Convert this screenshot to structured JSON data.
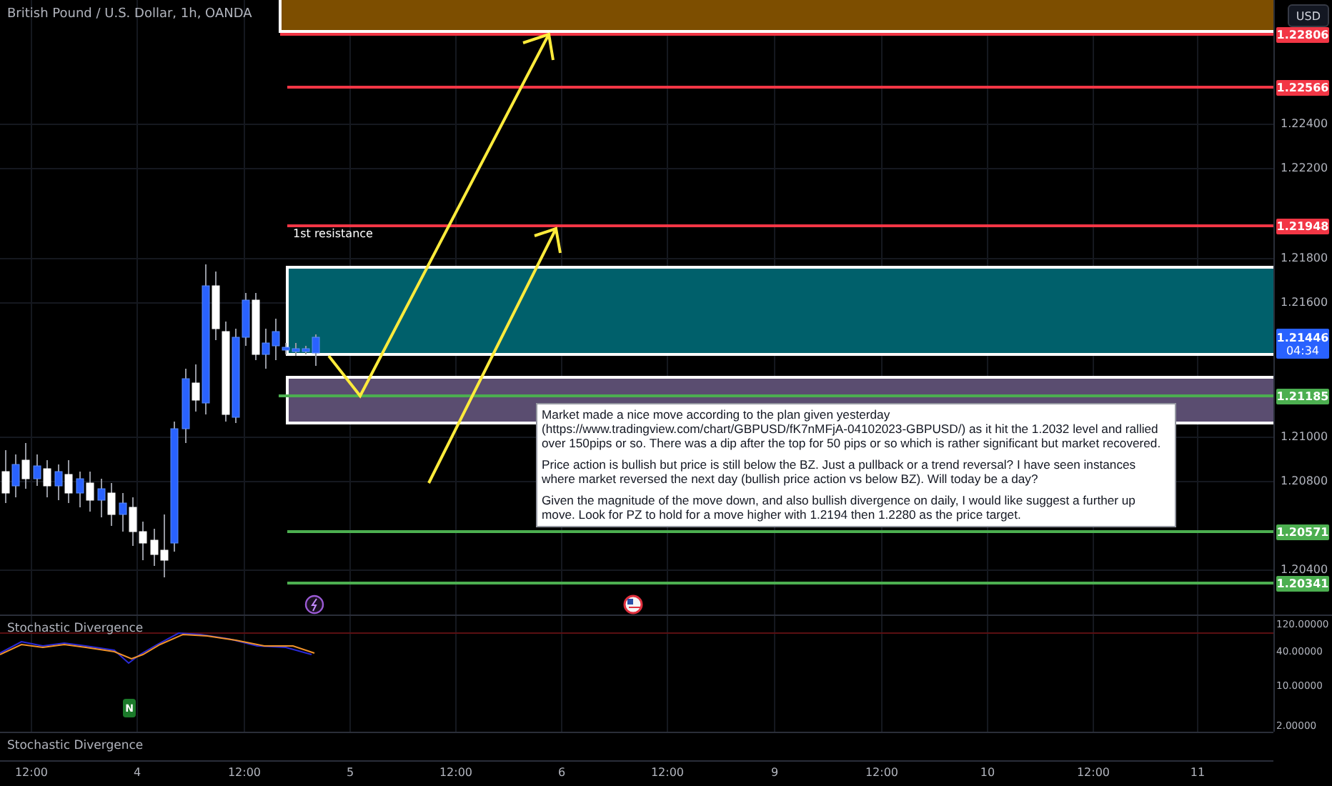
{
  "header": {
    "title": "British Pound / U.S. Dollar, 1h, OANDA",
    "currency_button": "USD"
  },
  "zones": [
    {
      "color": "#7d4e00"
    },
    {
      "color": "#00606b"
    },
    {
      "color": "#5a4d70"
    }
  ],
  "levels": [
    {
      "price": "1.22806",
      "color": "#f23645"
    },
    {
      "price": "1.22566",
      "color": "#f23645"
    },
    {
      "price": "1.21948",
      "color": "#f23645"
    },
    {
      "price": "1.21185",
      "color": "#4caf50"
    },
    {
      "price": "1.20571",
      "color": "#4caf50"
    },
    {
      "price": "1.20341",
      "color": "#4caf50"
    }
  ],
  "resistance_label": "1st resistance",
  "current_price": {
    "price": "1.21446",
    "countdown": "04:34"
  },
  "price_ticks": [
    "1.22400",
    "1.22200",
    "1.21800",
    "1.21600",
    "1.21000",
    "1.20800",
    "1.20400"
  ],
  "note": {
    "paragraphs": [
      "Market made a nice move according to the plan given yesterday (https://www.tradingview.com/chart/GBPUSD/fK7nMFjA-04102023-GBPUSD/) as it hit the 1.2032 level and rallied over 150pips or so. There was a dip after the top for 50 pips or so which is rather significant but market recovered.",
      "Price action is bullish but price is still below the BZ. Just a pullback or a trend reversal? I have seen instances where market reversed the next day (bullish price action vs below BZ). Will today be a day?",
      "Given the magnitude of the move down, and also bullish divergence on daily, I would like suggest a further up move. Look for PZ to hold for a move higher with 1.2194 then 1.2280 as the price target."
    ]
  },
  "indicator_pane": {
    "title": "Stochastic Divergence",
    "marker": "N",
    "ticks": [
      "120.00000",
      "40.00000",
      "10.00000",
      "2.00000"
    ]
  },
  "second_pane": {
    "title": "Stochastic Divergence"
  },
  "time_ticks": [
    "12:00",
    "4",
    "12:00",
    "5",
    "12:00",
    "6",
    "12:00",
    "9",
    "12:00",
    "10",
    "12:00",
    "11"
  ]
}
